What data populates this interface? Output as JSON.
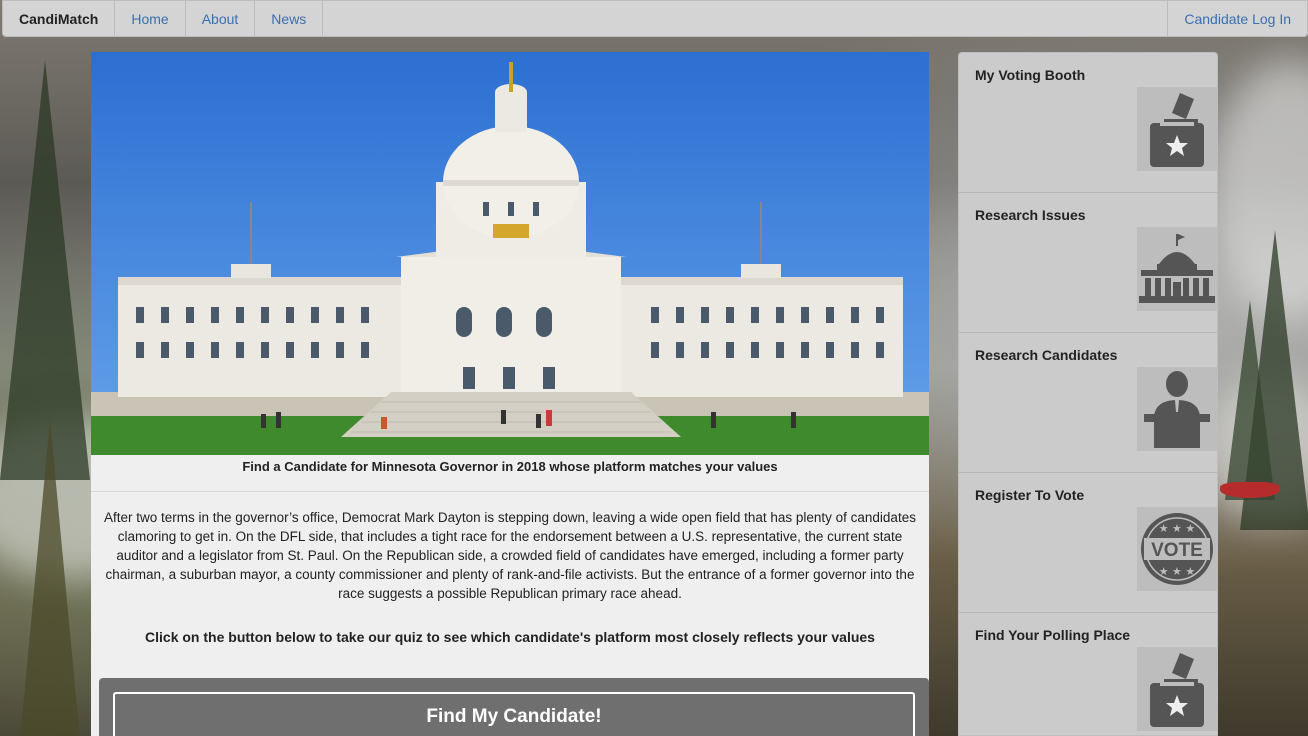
{
  "navbar": {
    "brand": "CandiMatch",
    "links": [
      "Home",
      "About",
      "News"
    ],
    "login": "Candidate Log In"
  },
  "hero": {
    "image": "Minnesota State Capitol building",
    "caption": "Find a Candidate for Minnesota Governor in 2018 whose platform matches your values"
  },
  "body": {
    "paragraph": "After two terms in the governor’s office, Democrat Mark Dayton is stepping down, leaving a wide open field that has plenty of candidates clamoring to get in. On the DFL side, that includes a tight race for the endorsement between a U.S. representative, the current state auditor and a legislator from St. Paul. On the Republican side, a crowded field of candidates have emerged, including a former party chairman, a suburban mayor, a county commissioner and plenty of rank-and-file activists. But the entrance of a former governor into the race suggests a possible Republican primary race ahead.",
    "quiz_prompt": "Click on the button below to take our quiz to see which candidate's platform most closely reflects your values",
    "cta_label": "Find My Candidate!"
  },
  "sidebar": {
    "items": [
      {
        "label": "My Voting Booth",
        "icon": "ballot-box-icon"
      },
      {
        "label": "Research Issues",
        "icon": "capitol-building-icon"
      },
      {
        "label": "Research Candidates",
        "icon": "candidate-podium-icon"
      },
      {
        "label": "Register To Vote",
        "icon": "vote-badge-icon"
      },
      {
        "label": "Find Your Polling Place",
        "icon": "ballot-box-icon"
      }
    ]
  },
  "colors": {
    "nav_bg": "#d4d4d4",
    "link": "#3a6fb0",
    "sidebar_bg": "#cbcbcb",
    "cta_bg": "#6f6f6f",
    "icon": "#555555"
  }
}
